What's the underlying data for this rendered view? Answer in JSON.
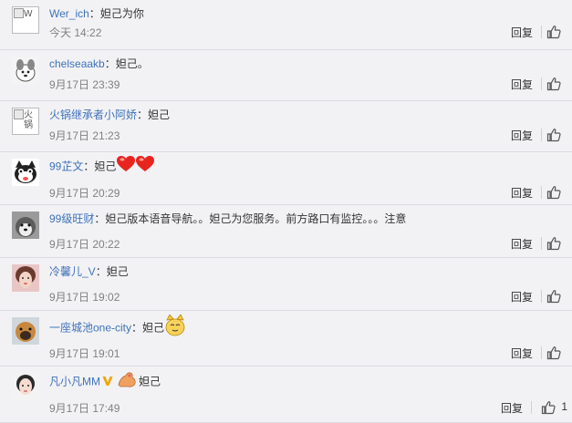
{
  "comments": [
    {
      "name": "Wer_ich",
      "sep": "：",
      "text": "妲己为你",
      "time": "今天 14:22",
      "reply": "回复",
      "avatar": "broken-image",
      "avatar_alt": "W",
      "likes": ""
    },
    {
      "name": "chelseaakb",
      "sep": "：",
      "text": "妲己。",
      "time": "9月17日 23:39",
      "reply": "回复",
      "avatar": "cartoon-dog",
      "likes": ""
    },
    {
      "name": "火锅继承者小阿娇",
      "sep": "：",
      "text": "妲己",
      "time": "9月17日 21:23",
      "reply": "回复",
      "avatar": "broken-image",
      "avatar_alt": "火锅",
      "likes": ""
    },
    {
      "name": "99芷文",
      "sep": "：",
      "text": "妲己",
      "time": "9月17日 20:29",
      "reply": "回复",
      "avatar": "cartoon-cat",
      "likes": "",
      "emoticons": [
        "heart-emoticon",
        "heart-emoticon"
      ]
    },
    {
      "name": "99级旺财",
      "sep": "：",
      "text": "妲己版本语音导航。。妲己为您服务。前方路口有监控。。。注意",
      "time": "9月17日 20:22",
      "reply": "回复",
      "avatar": "husky-photo",
      "likes": ""
    },
    {
      "name": "冷馨儿_V",
      "sep": "：",
      "text": "妲己",
      "time": "9月17日 19:02",
      "reply": "回复",
      "avatar": "girl-photo",
      "likes": ""
    },
    {
      "name": "一座城池one-city",
      "sep": "：",
      "text": "妲己",
      "time": "9月17日 19:01",
      "reply": "回复",
      "avatar": "dog-photo",
      "likes": "",
      "emoticons": [
        "cat-face-emoticon"
      ]
    },
    {
      "name": "凡小凡MM",
      "sep": "",
      "text": "妲己",
      "time": "9月17日 17:49",
      "reply": "回复",
      "avatar": "woman-photo",
      "likes": "1",
      "vip": true,
      "emoticons": [
        "flexing-arm-emoticon"
      ]
    }
  ],
  "colors": {
    "name": "#3e72b8",
    "background": "#f2f2f5",
    "time": "#808080",
    "vip": "#f5a300"
  },
  "icons": {
    "like": "thumbs-up-icon",
    "vip": "vip-badge-icon"
  }
}
